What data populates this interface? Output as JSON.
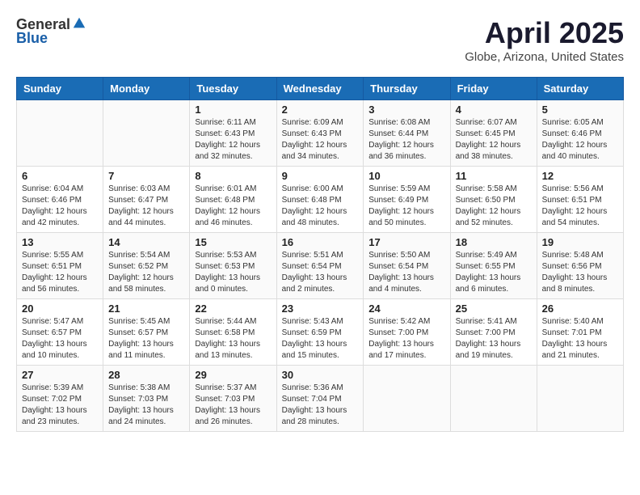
{
  "header": {
    "logo": {
      "general": "General",
      "blue": "Blue"
    },
    "title": "April 2025",
    "subtitle": "Globe, Arizona, United States"
  },
  "calendar": {
    "days_of_week": [
      "Sunday",
      "Monday",
      "Tuesday",
      "Wednesday",
      "Thursday",
      "Friday",
      "Saturday"
    ],
    "weeks": [
      [
        {
          "day": "",
          "info": ""
        },
        {
          "day": "",
          "info": ""
        },
        {
          "day": "1",
          "sunrise": "Sunrise: 6:11 AM",
          "sunset": "Sunset: 6:43 PM",
          "daylight": "Daylight: 12 hours and 32 minutes."
        },
        {
          "day": "2",
          "sunrise": "Sunrise: 6:09 AM",
          "sunset": "Sunset: 6:43 PM",
          "daylight": "Daylight: 12 hours and 34 minutes."
        },
        {
          "day": "3",
          "sunrise": "Sunrise: 6:08 AM",
          "sunset": "Sunset: 6:44 PM",
          "daylight": "Daylight: 12 hours and 36 minutes."
        },
        {
          "day": "4",
          "sunrise": "Sunrise: 6:07 AM",
          "sunset": "Sunset: 6:45 PM",
          "daylight": "Daylight: 12 hours and 38 minutes."
        },
        {
          "day": "5",
          "sunrise": "Sunrise: 6:05 AM",
          "sunset": "Sunset: 6:46 PM",
          "daylight": "Daylight: 12 hours and 40 minutes."
        }
      ],
      [
        {
          "day": "6",
          "sunrise": "Sunrise: 6:04 AM",
          "sunset": "Sunset: 6:46 PM",
          "daylight": "Daylight: 12 hours and 42 minutes."
        },
        {
          "day": "7",
          "sunrise": "Sunrise: 6:03 AM",
          "sunset": "Sunset: 6:47 PM",
          "daylight": "Daylight: 12 hours and 44 minutes."
        },
        {
          "day": "8",
          "sunrise": "Sunrise: 6:01 AM",
          "sunset": "Sunset: 6:48 PM",
          "daylight": "Daylight: 12 hours and 46 minutes."
        },
        {
          "day": "9",
          "sunrise": "Sunrise: 6:00 AM",
          "sunset": "Sunset: 6:48 PM",
          "daylight": "Daylight: 12 hours and 48 minutes."
        },
        {
          "day": "10",
          "sunrise": "Sunrise: 5:59 AM",
          "sunset": "Sunset: 6:49 PM",
          "daylight": "Daylight: 12 hours and 50 minutes."
        },
        {
          "day": "11",
          "sunrise": "Sunrise: 5:58 AM",
          "sunset": "Sunset: 6:50 PM",
          "daylight": "Daylight: 12 hours and 52 minutes."
        },
        {
          "day": "12",
          "sunrise": "Sunrise: 5:56 AM",
          "sunset": "Sunset: 6:51 PM",
          "daylight": "Daylight: 12 hours and 54 minutes."
        }
      ],
      [
        {
          "day": "13",
          "sunrise": "Sunrise: 5:55 AM",
          "sunset": "Sunset: 6:51 PM",
          "daylight": "Daylight: 12 hours and 56 minutes."
        },
        {
          "day": "14",
          "sunrise": "Sunrise: 5:54 AM",
          "sunset": "Sunset: 6:52 PM",
          "daylight": "Daylight: 12 hours and 58 minutes."
        },
        {
          "day": "15",
          "sunrise": "Sunrise: 5:53 AM",
          "sunset": "Sunset: 6:53 PM",
          "daylight": "Daylight: 13 hours and 0 minutes."
        },
        {
          "day": "16",
          "sunrise": "Sunrise: 5:51 AM",
          "sunset": "Sunset: 6:54 PM",
          "daylight": "Daylight: 13 hours and 2 minutes."
        },
        {
          "day": "17",
          "sunrise": "Sunrise: 5:50 AM",
          "sunset": "Sunset: 6:54 PM",
          "daylight": "Daylight: 13 hours and 4 minutes."
        },
        {
          "day": "18",
          "sunrise": "Sunrise: 5:49 AM",
          "sunset": "Sunset: 6:55 PM",
          "daylight": "Daylight: 13 hours and 6 minutes."
        },
        {
          "day": "19",
          "sunrise": "Sunrise: 5:48 AM",
          "sunset": "Sunset: 6:56 PM",
          "daylight": "Daylight: 13 hours and 8 minutes."
        }
      ],
      [
        {
          "day": "20",
          "sunrise": "Sunrise: 5:47 AM",
          "sunset": "Sunset: 6:57 PM",
          "daylight": "Daylight: 13 hours and 10 minutes."
        },
        {
          "day": "21",
          "sunrise": "Sunrise: 5:45 AM",
          "sunset": "Sunset: 6:57 PM",
          "daylight": "Daylight: 13 hours and 11 minutes."
        },
        {
          "day": "22",
          "sunrise": "Sunrise: 5:44 AM",
          "sunset": "Sunset: 6:58 PM",
          "daylight": "Daylight: 13 hours and 13 minutes."
        },
        {
          "day": "23",
          "sunrise": "Sunrise: 5:43 AM",
          "sunset": "Sunset: 6:59 PM",
          "daylight": "Daylight: 13 hours and 15 minutes."
        },
        {
          "day": "24",
          "sunrise": "Sunrise: 5:42 AM",
          "sunset": "Sunset: 7:00 PM",
          "daylight": "Daylight: 13 hours and 17 minutes."
        },
        {
          "day": "25",
          "sunrise": "Sunrise: 5:41 AM",
          "sunset": "Sunset: 7:00 PM",
          "daylight": "Daylight: 13 hours and 19 minutes."
        },
        {
          "day": "26",
          "sunrise": "Sunrise: 5:40 AM",
          "sunset": "Sunset: 7:01 PM",
          "daylight": "Daylight: 13 hours and 21 minutes."
        }
      ],
      [
        {
          "day": "27",
          "sunrise": "Sunrise: 5:39 AM",
          "sunset": "Sunset: 7:02 PM",
          "daylight": "Daylight: 13 hours and 23 minutes."
        },
        {
          "day": "28",
          "sunrise": "Sunrise: 5:38 AM",
          "sunset": "Sunset: 7:03 PM",
          "daylight": "Daylight: 13 hours and 24 minutes."
        },
        {
          "day": "29",
          "sunrise": "Sunrise: 5:37 AM",
          "sunset": "Sunset: 7:03 PM",
          "daylight": "Daylight: 13 hours and 26 minutes."
        },
        {
          "day": "30",
          "sunrise": "Sunrise: 5:36 AM",
          "sunset": "Sunset: 7:04 PM",
          "daylight": "Daylight: 13 hours and 28 minutes."
        },
        {
          "day": "",
          "info": ""
        },
        {
          "day": "",
          "info": ""
        },
        {
          "day": "",
          "info": ""
        }
      ]
    ]
  }
}
